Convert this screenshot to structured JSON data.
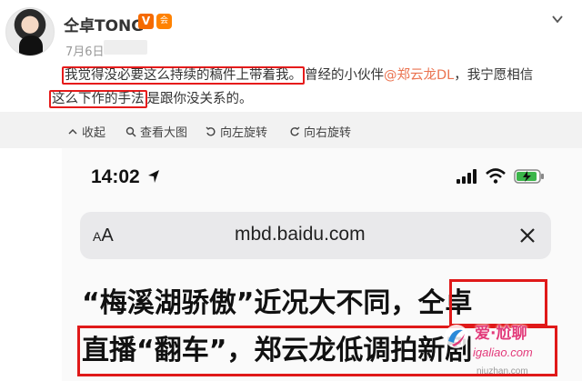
{
  "post": {
    "username": "仝卓TONG",
    "vip_badge": "V",
    "member_badge": "会",
    "date": "7月6日",
    "text_hl1": "我觉得没必要这么持续的稿件上带着我。",
    "text_mid": "曾经的小伙伴",
    "mention": "@郑云龙DL",
    "text_after_mention": "，我宁愿相信",
    "text_hl2": "这么下作的手法",
    "text_end": "是跟你没关系的。"
  },
  "actions": {
    "collapse": "收起",
    "view_large": "查看大图",
    "rotate_left": "向左旋转",
    "rotate_right": "向右旋转"
  },
  "screenshot": {
    "time": "14:02",
    "aa_small": "A",
    "aa_large": "A",
    "url": "mbd.baidu.com",
    "headline_1": "“梅溪湖骄傲”近况大不同，仝卓",
    "headline_2": "直播“翻车”，郑云龙低调拍新剧"
  },
  "watermark": {
    "name": "爱·尬聊",
    "domain": "igaliao.com",
    "sub": "niuzhan.com"
  },
  "colors": {
    "highlight_box": "#e61b1b",
    "mention": "#eb7350",
    "action_bar_bg": "#f2f2f2",
    "vip_orange": "#f56a00"
  }
}
